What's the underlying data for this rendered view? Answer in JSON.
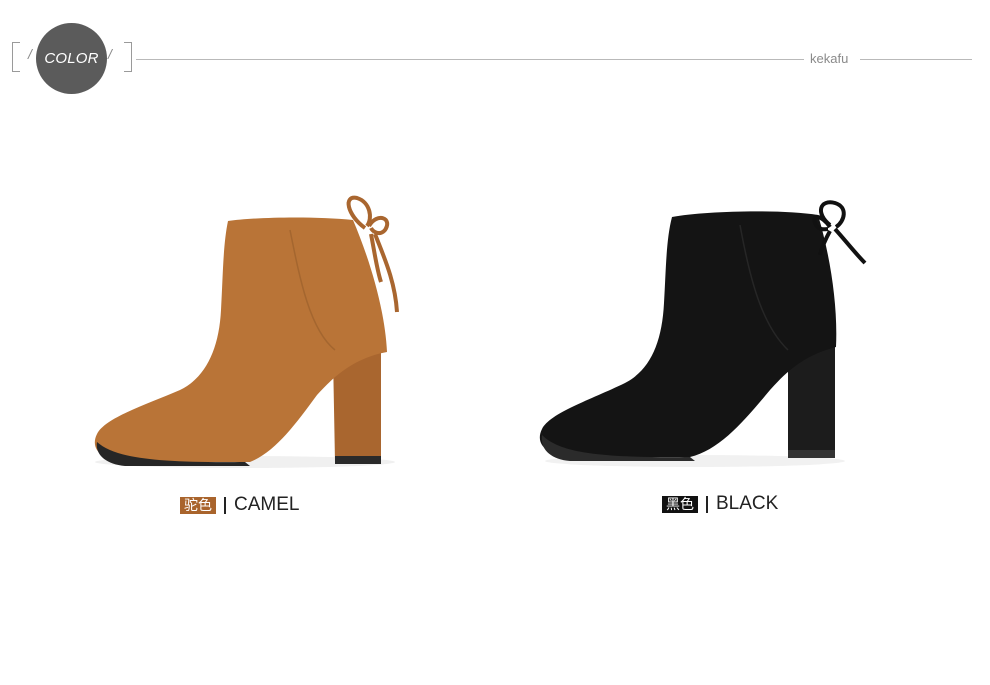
{
  "header": {
    "badge_text": "COLOR",
    "slash": "/",
    "brand": "kekafu"
  },
  "products": [
    {
      "tag": "驼色",
      "color_name": "CAMEL",
      "tag_color": "#a9642c",
      "boot_color": "#b97437"
    },
    {
      "tag": "黑色",
      "color_name": "BLACK",
      "tag_color": "#111111",
      "boot_color": "#141414"
    }
  ]
}
